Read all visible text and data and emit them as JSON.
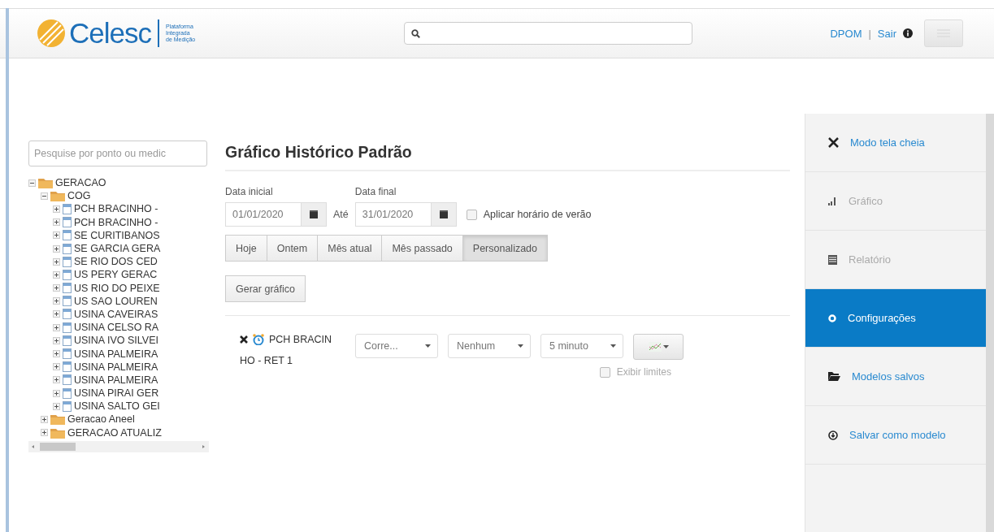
{
  "header": {
    "brand": "Celesc",
    "tagline": [
      "Plataforma",
      "Integrada",
      "de Medição"
    ],
    "user": "DPOM",
    "separator": "|",
    "logout": "Sair"
  },
  "tree": {
    "search": {
      "placeholder": "Pesquise por ponto ou medic"
    },
    "nodes": [
      {
        "label": "GERACAO",
        "kind": "folder",
        "expanded": true,
        "children": [
          {
            "label": "COG",
            "kind": "folder",
            "expanded": true,
            "children": [
              {
                "label": "PCH BRACINHO -",
                "kind": "point",
                "expanded": false
              },
              {
                "label": "PCH BRACINHO -",
                "kind": "point",
                "expanded": false
              },
              {
                "label": "SE CURITIBANOS",
                "kind": "point",
                "expanded": false
              },
              {
                "label": "SE GARCIA GERA",
                "kind": "point",
                "expanded": false
              },
              {
                "label": "SE RIO DOS CED",
                "kind": "point",
                "expanded": false
              },
              {
                "label": "US PERY GERAC",
                "kind": "point",
                "expanded": false
              },
              {
                "label": "US RIO DO PEIXE",
                "kind": "point",
                "expanded": false
              },
              {
                "label": "US SAO LOUREN",
                "kind": "point",
                "expanded": false
              },
              {
                "label": "USINA CAVEIRAS",
                "kind": "point",
                "expanded": false
              },
              {
                "label": "USINA CELSO RA",
                "kind": "point",
                "expanded": false
              },
              {
                "label": "USINA IVO SILVEI",
                "kind": "point",
                "expanded": false
              },
              {
                "label": "USINA PALMEIRA",
                "kind": "point",
                "expanded": false
              },
              {
                "label": "USINA PALMEIRA",
                "kind": "point",
                "expanded": false
              },
              {
                "label": "USINA PALMEIRA",
                "kind": "point",
                "expanded": false
              },
              {
                "label": "USINA PIRAI GER",
                "kind": "point",
                "expanded": false
              },
              {
                "label": "USINA SALTO GEI",
                "kind": "point",
                "expanded": false
              }
            ]
          },
          {
            "label": "Geracao Aneel",
            "kind": "folder",
            "expanded": false
          },
          {
            "label": "GERACAO ATUALIZ",
            "kind": "folder",
            "expanded": false
          }
        ]
      }
    ]
  },
  "main": {
    "title": "Gráfico Histórico Padrão",
    "start_label": "Data inicial",
    "start_date": "01/01/2020",
    "until": "Até",
    "end_label": "Data final",
    "end_date": "31/01/2020",
    "dst": {
      "label": "Aplicar horário de verão",
      "checked": false
    },
    "periods": [
      {
        "label": "Hoje",
        "selected": false
      },
      {
        "label": "Ontem",
        "selected": false
      },
      {
        "label": "Mês atual",
        "selected": false
      },
      {
        "label": "Mês passado",
        "selected": false
      },
      {
        "label": "Personalizado",
        "selected": true
      }
    ],
    "generate": "Gerar gráfico",
    "series": [
      {
        "name_lines": [
          "PCH BRACIN",
          "HO - RET 1"
        ],
        "selects": [
          "Corre...",
          "Nenhum",
          "5 minuto"
        ],
        "show_limits": {
          "label": "Exibir limites",
          "checked": false
        }
      }
    ]
  },
  "menu": [
    {
      "label": "Modo tela cheia",
      "selected": false,
      "disabled": false
    },
    {
      "label": "Gráfico",
      "selected": false,
      "disabled": true
    },
    {
      "label": "Relatório",
      "selected": false,
      "disabled": true
    },
    {
      "label": "Configurações",
      "selected": true,
      "disabled": false
    },
    {
      "label": "Modelos salvos",
      "selected": false,
      "disabled": false
    },
    {
      "label": "Salvar como modelo",
      "selected": false,
      "disabled": false
    }
  ]
}
